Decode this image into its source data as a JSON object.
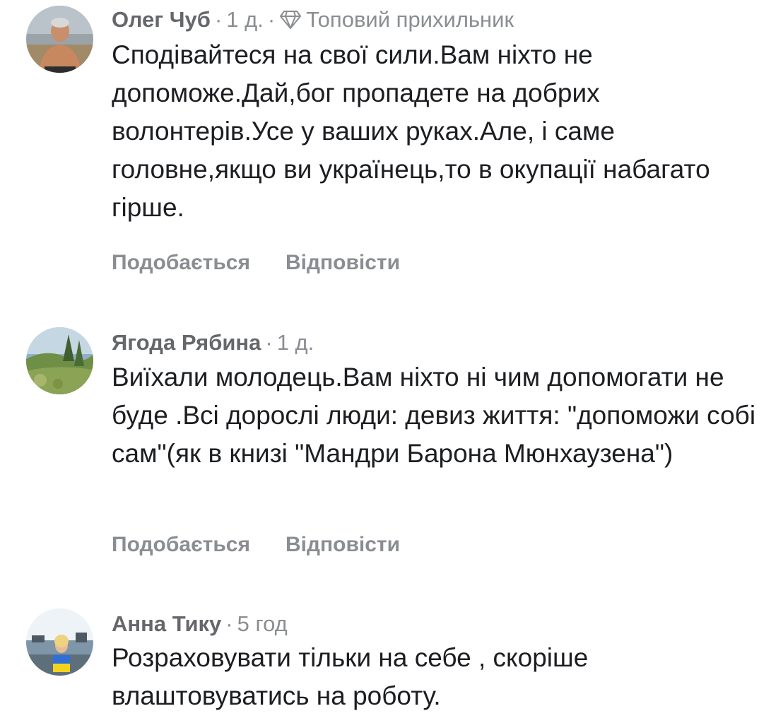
{
  "comments": [
    {
      "author": "Олег Чуб",
      "time": "1 д.",
      "badge": "Топовий прихильник",
      "badge_icon": "diamond-icon",
      "text": "Сподівайтеся на свої сили.Вам ніхто не допоможе.Дай,бог пропадете на добрих волонтерів.Усе у ваших руках.Але, і саме головне,якщо ви українець,то в окупації набагато гірше.",
      "like_label": "Подобається",
      "reply_label": "Відповісти"
    },
    {
      "author": "Ягода Рябина",
      "time": "1 д.",
      "text": "Виїхали молодець.Вам ніхто ні чим допомогати не буде .Всі дорослі люди: девиз життя: \"допоможи собі сам\"(як в книзі \"Мандри Барона Мюнхаузена\")",
      "like_label": "Подобається",
      "reply_label": "Відповісти"
    },
    {
      "author": "Анна Тику",
      "time": "5 год",
      "text": "Розраховувати тільки на себе , скоріше влаштовуватись на роботу."
    }
  ],
  "separator": "·",
  "colors": {
    "author": "#65676b",
    "meta": "#8a8d91",
    "text": "#1c1e21"
  }
}
